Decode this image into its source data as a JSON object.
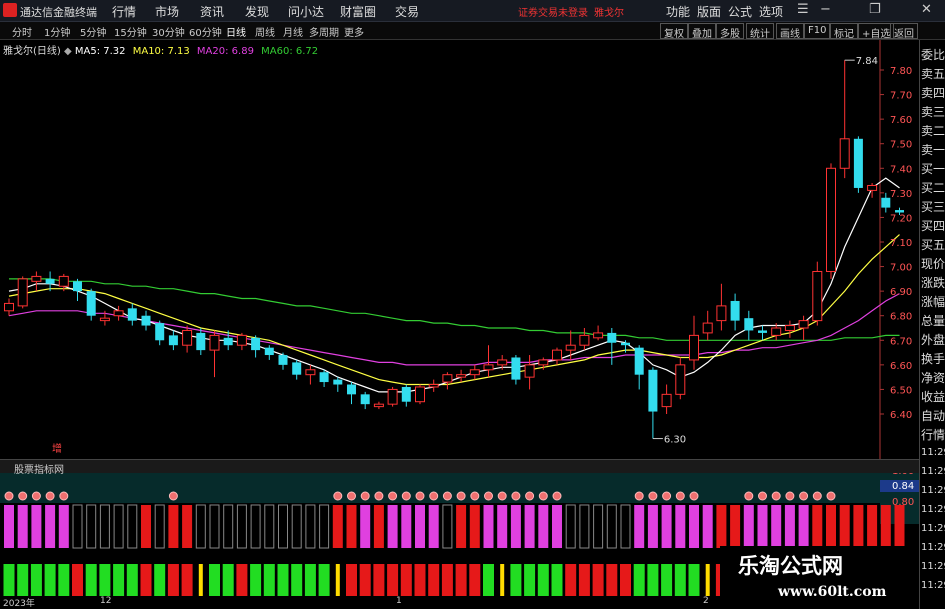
{
  "app": {
    "title": "通达信金融终端",
    "login_warning": "证券交易未登录",
    "stock_link": "雅戈尔"
  },
  "menu": [
    "行情",
    "市场",
    "资讯",
    "发现",
    "问小达",
    "财富圈",
    "交易"
  ],
  "right_tools": [
    "功能",
    "版面",
    "公式",
    "选项"
  ],
  "periods": [
    "分时",
    "1分钟",
    "5分钟",
    "15分钟",
    "30分钟",
    "60分钟",
    "日线",
    "周线",
    "月线",
    "多周期",
    "更多"
  ],
  "toolbar_buttons": [
    "复权",
    "叠加",
    "多股",
    "统计",
    "画线",
    "F10",
    "标记",
    "+自选",
    "返回"
  ],
  "stock_label": "雅戈尔(日线)",
  "ma": [
    {
      "label": "MA5: 7.32",
      "color": "#ffffff"
    },
    {
      "label": "MA10: 7.13",
      "color": "#ffff44"
    },
    {
      "label": "MA20: 6.89",
      "color": "#e040e0"
    },
    {
      "label": "MA60: 6.72",
      "color": "#33cc33"
    }
  ],
  "price_axis": [
    "7.80",
    "7.70",
    "7.60",
    "7.50",
    "7.40",
    "7.30",
    "7.20",
    "7.10",
    "7.00",
    "6.90",
    "6.80",
    "6.70",
    "6.60",
    "6.50",
    "6.40"
  ],
  "high_label": "7.84",
  "low_label": "6.30",
  "zeng_label": "增",
  "indicator": {
    "name": "股票指标网",
    "axis": [
      "1.00",
      "0.84",
      "0.80"
    ]
  },
  "side_panel": [
    "委比",
    "卖五",
    "卖四",
    "卖三",
    "卖二",
    "卖一",
    "买一",
    "买二",
    "买三",
    "买四",
    "买五",
    "现价",
    "涨跌",
    "涨幅",
    "总量",
    "外盘",
    "换手",
    "净资",
    "收益",
    "自动",
    "行情"
  ],
  "side_times": [
    "11:29",
    "11:29",
    "11:29",
    "11:29",
    "11:29",
    "11:29",
    "11:29",
    "11:29"
  ],
  "dates": [
    "2023年",
    "12",
    "1",
    "2"
  ],
  "watermark": {
    "title": "乐淘公式网",
    "url": "www.60lt.com"
  },
  "colors": {
    "up": "#ff3333",
    "down": "#33ddee",
    "ma5": "#ffffff",
    "ma10": "#ffff44",
    "ma20": "#e040e0",
    "ma60": "#33cc33"
  },
  "chart_data": {
    "type": "candlestick",
    "candles": [
      [
        6.82,
        6.85,
        6.8,
        6.87
      ],
      [
        6.84,
        6.95,
        6.83,
        6.96
      ],
      [
        6.94,
        6.96,
        6.9,
        6.98
      ],
      [
        6.95,
        6.93,
        6.9,
        6.98
      ],
      [
        6.92,
        6.96,
        6.9,
        6.97
      ],
      [
        6.94,
        6.9,
        6.86,
        6.95
      ],
      [
        6.9,
        6.8,
        6.78,
        6.91
      ],
      [
        6.78,
        6.79,
        6.76,
        6.82
      ],
      [
        6.8,
        6.82,
        6.78,
        6.84
      ],
      [
        6.83,
        6.78,
        6.76,
        6.85
      ],
      [
        6.8,
        6.76,
        6.74,
        6.82
      ],
      [
        6.77,
        6.7,
        6.68,
        6.78
      ],
      [
        6.72,
        6.68,
        6.66,
        6.74
      ],
      [
        6.68,
        6.74,
        6.65,
        6.76
      ],
      [
        6.73,
        6.66,
        6.64,
        6.75
      ],
      [
        6.66,
        6.72,
        6.55,
        6.74
      ],
      [
        6.71,
        6.68,
        6.66,
        6.74
      ],
      [
        6.68,
        6.72,
        6.66,
        6.73
      ],
      [
        6.71,
        6.66,
        6.63,
        6.72
      ],
      [
        6.67,
        6.64,
        6.62,
        6.68
      ],
      [
        6.64,
        6.6,
        6.58,
        6.65
      ],
      [
        6.61,
        6.56,
        6.54,
        6.62
      ],
      [
        6.56,
        6.58,
        6.52,
        6.6
      ],
      [
        6.57,
        6.53,
        6.51,
        6.58
      ],
      [
        6.54,
        6.52,
        6.49,
        6.55
      ],
      [
        6.52,
        6.48,
        6.44,
        6.53
      ],
      [
        6.48,
        6.44,
        6.42,
        6.49
      ],
      [
        6.43,
        6.44,
        6.42,
        6.45
      ],
      [
        6.44,
        6.5,
        6.43,
        6.51
      ],
      [
        6.51,
        6.45,
        6.43,
        6.52
      ],
      [
        6.45,
        6.51,
        6.44,
        6.52
      ],
      [
        6.51,
        6.52,
        6.49,
        6.54
      ],
      [
        6.53,
        6.56,
        6.5,
        6.57
      ],
      [
        6.55,
        6.56,
        6.53,
        6.58
      ],
      [
        6.56,
        6.58,
        6.54,
        6.6
      ],
      [
        6.58,
        6.6,
        6.55,
        6.68
      ],
      [
        6.6,
        6.62,
        6.58,
        6.64
      ],
      [
        6.63,
        6.54,
        6.52,
        6.64
      ],
      [
        6.55,
        6.6,
        6.5,
        6.64
      ],
      [
        6.6,
        6.62,
        6.58,
        6.63
      ],
      [
        6.62,
        6.66,
        6.6,
        6.67
      ],
      [
        6.66,
        6.68,
        6.62,
        6.74
      ],
      [
        6.68,
        6.72,
        6.66,
        6.75
      ],
      [
        6.71,
        6.73,
        6.7,
        6.76
      ],
      [
        6.73,
        6.69,
        6.6,
        6.75
      ],
      [
        6.69,
        6.68,
        6.65,
        6.7
      ],
      [
        6.67,
        6.56,
        6.5,
        6.68
      ],
      [
        6.58,
        6.41,
        6.3,
        6.59
      ],
      [
        6.43,
        6.48,
        6.4,
        6.52
      ],
      [
        6.48,
        6.6,
        6.46,
        6.63
      ],
      [
        6.62,
        6.72,
        6.58,
        6.8
      ],
      [
        6.73,
        6.77,
        6.7,
        6.82
      ],
      [
        6.78,
        6.84,
        6.74,
        6.93
      ],
      [
        6.86,
        6.78,
        6.74,
        6.89
      ],
      [
        6.79,
        6.74,
        6.7,
        6.82
      ],
      [
        6.74,
        6.73,
        6.7,
        6.76
      ],
      [
        6.72,
        6.75,
        6.7,
        6.77
      ],
      [
        6.74,
        6.76,
        6.71,
        6.78
      ],
      [
        6.75,
        6.78,
        6.7,
        6.8
      ],
      [
        6.78,
        6.98,
        6.76,
        7.02
      ],
      [
        6.98,
        7.4,
        6.95,
        7.42
      ],
      [
        7.4,
        7.52,
        7.36,
        7.84
      ],
      [
        7.52,
        7.32,
        7.3,
        7.53
      ],
      [
        7.31,
        7.33,
        7.28,
        7.34
      ],
      [
        7.28,
        7.24,
        7.22,
        7.3
      ],
      [
        7.23,
        7.22,
        7.21,
        7.24
      ]
    ],
    "ma5": [
      6.9,
      6.91,
      6.93,
      6.93,
      6.92,
      6.9,
      6.88,
      6.85,
      6.82,
      6.79,
      6.78,
      6.76,
      6.74,
      6.72,
      6.71,
      6.7,
      6.7,
      6.69,
      6.68,
      6.66,
      6.64,
      6.62,
      6.6,
      6.58,
      6.55,
      6.53,
      6.51,
      6.49,
      6.49,
      6.49,
      6.5,
      6.51,
      6.53,
      6.55,
      6.57,
      6.58,
      6.59,
      6.59,
      6.6,
      6.61,
      6.62,
      6.64,
      6.66,
      6.68,
      6.7,
      6.69,
      6.65,
      6.6,
      6.58,
      6.55,
      6.57,
      6.61,
      6.66,
      6.72,
      6.75,
      6.76,
      6.76,
      6.76,
      6.77,
      6.82,
      6.93,
      7.08,
      7.2,
      7.32,
      7.36,
      7.32
    ],
    "ma10": [
      6.88,
      6.89,
      6.9,
      6.91,
      6.91,
      6.91,
      6.9,
      6.89,
      6.87,
      6.85,
      6.83,
      6.81,
      6.79,
      6.77,
      6.75,
      6.74,
      6.73,
      6.72,
      6.71,
      6.7,
      6.68,
      6.66,
      6.64,
      6.62,
      6.6,
      6.58,
      6.56,
      6.54,
      6.53,
      6.52,
      6.52,
      6.52,
      6.52,
      6.53,
      6.54,
      6.55,
      6.56,
      6.57,
      6.58,
      6.59,
      6.6,
      6.61,
      6.62,
      6.64,
      6.65,
      6.66,
      6.66,
      6.65,
      6.64,
      6.63,
      6.63,
      6.63,
      6.64,
      6.66,
      6.68,
      6.7,
      6.72,
      6.73,
      6.75,
      6.78,
      6.84,
      6.9,
      6.97,
      7.03,
      7.08,
      7.13
    ],
    "ma20": [
      6.8,
      6.81,
      6.82,
      6.82,
      6.82,
      6.82,
      6.81,
      6.81,
      6.8,
      6.79,
      6.78,
      6.77,
      6.76,
      6.75,
      6.74,
      6.73,
      6.72,
      6.71,
      6.7,
      6.69,
      6.68,
      6.67,
      6.66,
      6.65,
      6.64,
      6.63,
      6.62,
      6.61,
      6.61,
      6.6,
      6.6,
      6.6,
      6.6,
      6.6,
      6.6,
      6.61,
      6.61,
      6.61,
      6.61,
      6.62,
      6.62,
      6.62,
      6.63,
      6.63,
      6.63,
      6.64,
      6.64,
      6.64,
      6.64,
      6.64,
      6.64,
      6.65,
      6.65,
      6.66,
      6.66,
      6.67,
      6.67,
      6.68,
      6.69,
      6.7,
      6.72,
      6.75,
      6.78,
      6.82,
      6.86,
      6.89
    ],
    "ma60": [
      6.95,
      6.95,
      6.95,
      6.95,
      6.94,
      6.94,
      6.94,
      6.93,
      6.93,
      6.92,
      6.92,
      6.91,
      6.91,
      6.9,
      6.89,
      6.89,
      6.88,
      6.87,
      6.87,
      6.86,
      6.85,
      6.84,
      6.84,
      6.83,
      6.82,
      6.81,
      6.81,
      6.8,
      6.79,
      6.78,
      6.78,
      6.77,
      6.77,
      6.76,
      6.76,
      6.75,
      6.75,
      6.75,
      6.74,
      6.74,
      6.73,
      6.73,
      6.73,
      6.72,
      6.72,
      6.72,
      6.71,
      6.71,
      6.7,
      6.7,
      6.7,
      6.7,
      6.7,
      6.7,
      6.7,
      6.7,
      6.7,
      6.7,
      6.7,
      6.7,
      6.7,
      6.71,
      6.71,
      6.71,
      6.72,
      6.72
    ],
    "indicator_bars": [
      "m",
      "m",
      "m",
      "m",
      "m",
      "k",
      "k",
      "k",
      "k",
      "k",
      "r",
      "k",
      "r",
      "r",
      "k",
      "k",
      "k",
      "k",
      "k",
      "k",
      "k",
      "k",
      "k",
      "k",
      "r",
      "r",
      "m",
      "r",
      "m",
      "m",
      "m",
      "m",
      "k",
      "r",
      "r",
      "m",
      "m",
      "m",
      "m",
      "m",
      "m",
      "k",
      "k",
      "k",
      "k",
      "k",
      "m",
      "m",
      "m",
      "m",
      "m",
      "m",
      "r",
      "r",
      "m",
      "m",
      "m",
      "m",
      "m",
      "r",
      "r",
      "r",
      "r",
      "r",
      "r",
      "r"
    ],
    "signal_dots": [
      1,
      1,
      1,
      1,
      1,
      0,
      0,
      0,
      0,
      0,
      0,
      0,
      1,
      0,
      0,
      0,
      0,
      0,
      0,
      0,
      0,
      0,
      0,
      0,
      1,
      1,
      1,
      1,
      1,
      1,
      1,
      1,
      1,
      1,
      1,
      1,
      1,
      1,
      1,
      1,
      1,
      0,
      0,
      0,
      0,
      0,
      1,
      1,
      1,
      1,
      1,
      0,
      0,
      0,
      1,
      1,
      1,
      1,
      1,
      1,
      1,
      0,
      0,
      0,
      0,
      0
    ],
    "lower_bars": [
      "g",
      "g",
      "g",
      "g",
      "g",
      "r",
      "g",
      "g",
      "g",
      "g",
      "r",
      "g",
      "r",
      "r",
      "y",
      "g",
      "g",
      "r",
      "g",
      "g",
      "g",
      "g",
      "g",
      "g",
      "y",
      "r",
      "r",
      "r",
      "r",
      "r",
      "r",
      "r",
      "r",
      "r",
      "r",
      "g",
      "y",
      "g",
      "g",
      "g",
      "g",
      "r",
      "r",
      "r",
      "r",
      "r",
      "g",
      "g",
      "g",
      "g",
      "g",
      "y",
      "r",
      "r",
      "r",
      "r",
      "r",
      "g",
      "g",
      "g",
      "g",
      "r",
      "r",
      "r",
      "r",
      "r"
    ]
  }
}
